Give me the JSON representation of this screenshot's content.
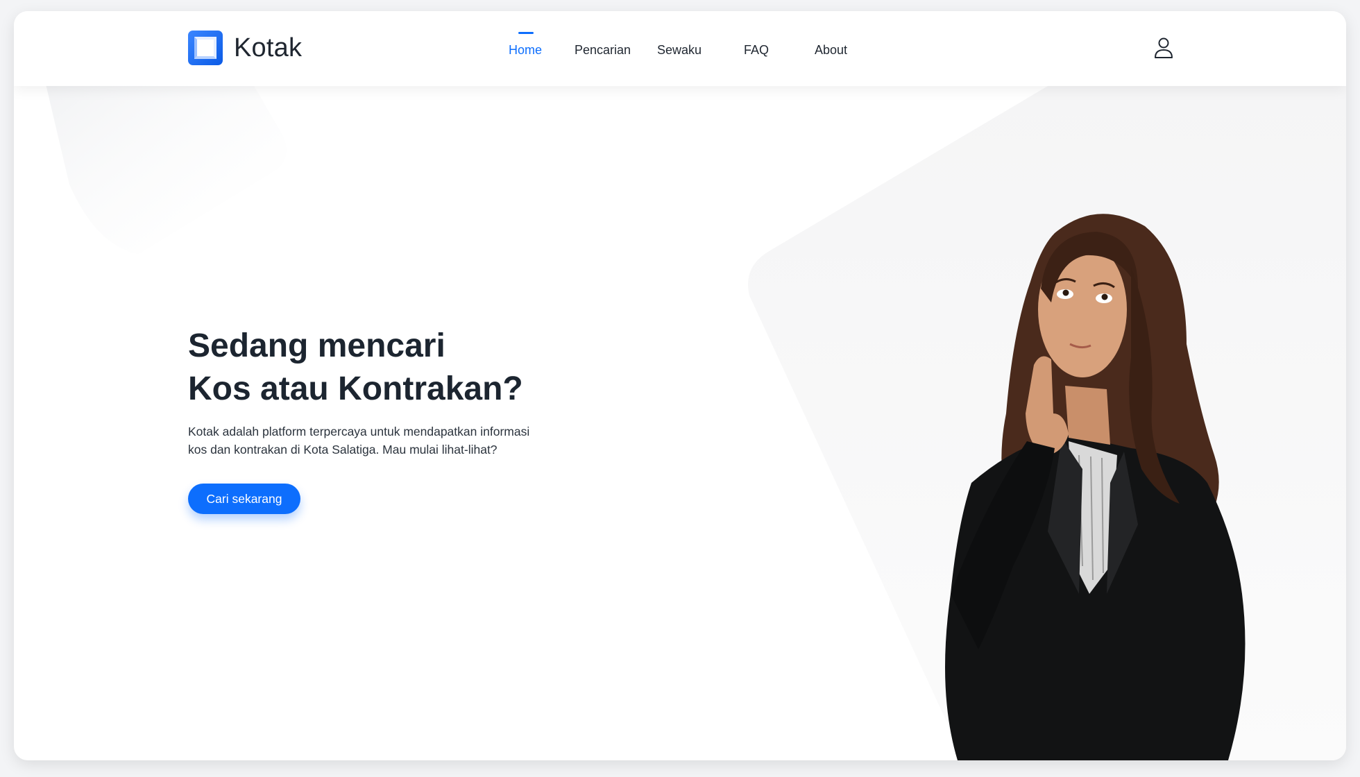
{
  "brand": {
    "name": "Kotak"
  },
  "nav": {
    "items": [
      {
        "label": "Home",
        "active": true
      },
      {
        "label": "Pencarian",
        "active": false
      },
      {
        "label": "Sewaku",
        "active": false
      },
      {
        "label": "FAQ",
        "active": false
      },
      {
        "label": "About",
        "active": false
      }
    ],
    "user_icon": "user-outline-icon"
  },
  "hero": {
    "title_line1": "Sedang mencari",
    "title_line2": "Kos atau Kontrakan?",
    "desc_line1": "Kotak adalah platform terpercaya untuk mendapatkan informasi",
    "desc_line2": "kos dan kontrakan di Kota Salatiga. Mau mulai lihat-lihat?",
    "cta_label": "Cari sekarang"
  },
  "colors": {
    "accent": "#0d6efd",
    "text_dark": "#1c2530",
    "background": "#ffffff"
  }
}
